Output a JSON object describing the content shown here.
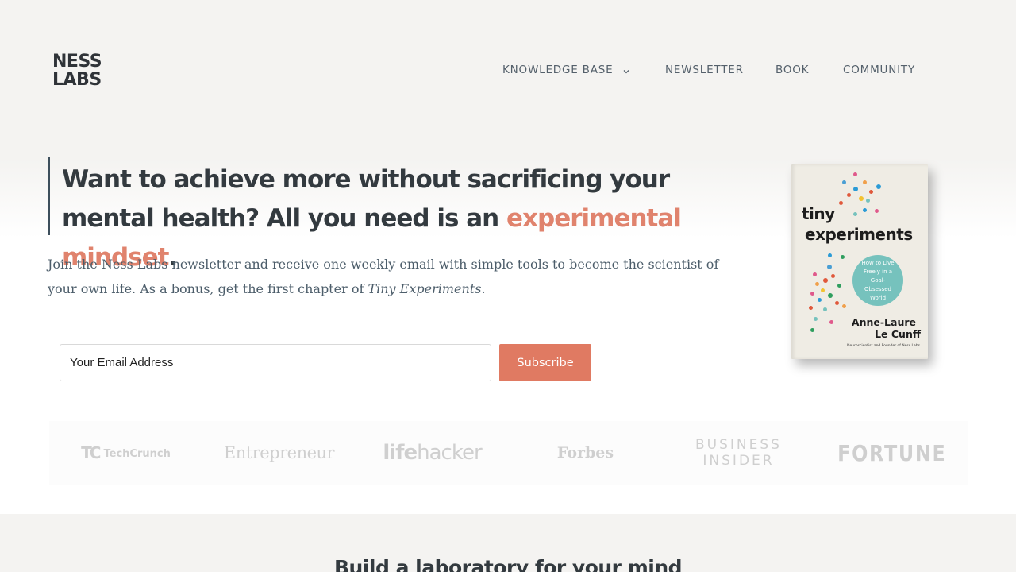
{
  "header": {
    "logo_line1": "NESS",
    "logo_line2": "LABS",
    "nav": [
      {
        "label": "KNOWLEDGE BASE"
      },
      {
        "label": "NEWSLETTER"
      },
      {
        "label": "BOOK"
      },
      {
        "label": "COMMUNITY"
      }
    ]
  },
  "hero": {
    "headline_bold": "Want to achieve more without sacrificing your mental health?",
    "headline_plain": " All you need is an ",
    "headline_accent": "experimental mindset",
    "headline_end": ".",
    "sub_text": "Join the Ness Labs newsletter and receive one weekly email with simple tools to become the scientist of your own life. As a bonus, get the first chapter of ",
    "sub_italic": "Tiny Experiments",
    "sub_end": ".",
    "email_placeholder": "Your Email Address",
    "subscribe_label": "Subscribe"
  },
  "book": {
    "title_line1": "tiny",
    "title_line2": "experiments",
    "subtitle": "How to Live Freely in a Goal-Obsessed World",
    "author_line1": "Anne-Laure",
    "author_line2": "Le Cunff",
    "author_tag": "Neuroscientist and Founder of Ness Labs"
  },
  "press": {
    "techcrunch": "TechCrunch",
    "techcrunch_mark": "TC",
    "entrepreneur": "Entrepreneur",
    "lifehacker_a": "life",
    "lifehacker_b": "hacker",
    "forbes": "Forbes",
    "bi_line1": "BUSINESS",
    "bi_line2": "INSIDER",
    "fortune": "FORTUNE"
  },
  "section2": {
    "title": "Build a laboratory for your mind"
  },
  "colors": {
    "accent": "#e07a62",
    "text_dark": "#333a3f",
    "book_circle": "#76c2bd"
  }
}
